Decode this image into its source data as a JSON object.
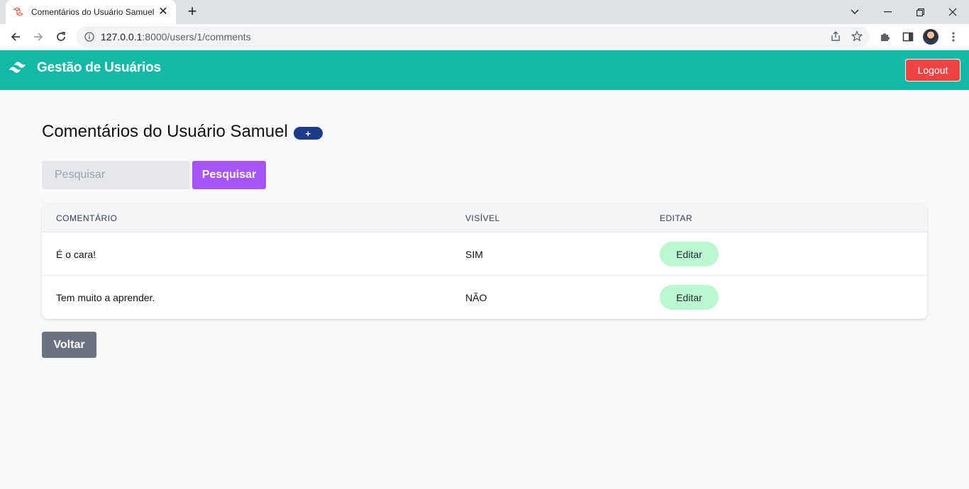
{
  "browser": {
    "tab_title": "Comentários do Usuário Samuel",
    "url_host": "127.0.0.1",
    "url_rest": ":8000/users/1/comments"
  },
  "header": {
    "brand": "Gestão de Usuários",
    "logout_label": "Logout"
  },
  "page": {
    "title": "Comentários do Usuário Samuel",
    "add_label": "+"
  },
  "search": {
    "placeholder": "Pesquisar",
    "button_label": "Pesquisar"
  },
  "table": {
    "headers": [
      "COMENTÁRIO",
      "VISÍVEL",
      "EDITAR"
    ],
    "rows": [
      {
        "comment": "É o cara!",
        "visible": "SIM",
        "edit_label": "Editar"
      },
      {
        "comment": "Tem muito a aprender.",
        "visible": "NÃO",
        "edit_label": "Editar"
      }
    ]
  },
  "back_label": "Voltar",
  "colors": {
    "header_bg": "#14b8a6",
    "logout_bg": "#ef4444",
    "search_btn_bg": "#a855f7",
    "edit_btn_bg": "#bbf7d0",
    "back_btn_bg": "#6b7280",
    "badge_bg": "#1e3a8a"
  }
}
